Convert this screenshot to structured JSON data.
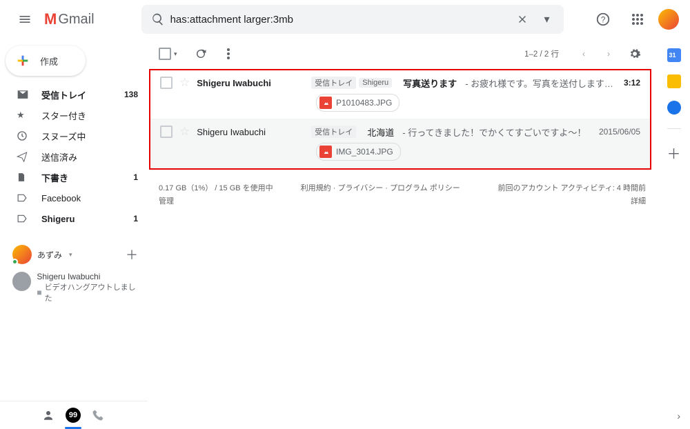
{
  "header": {
    "logo_text": "Gmail",
    "search_value": "has:attachment larger:3mb"
  },
  "compose_label": "作成",
  "nav": [
    {
      "icon": "inbox",
      "label": "受信トレイ",
      "badge": "138",
      "bold": true
    },
    {
      "icon": "star",
      "label": "スター付き",
      "badge": "",
      "bold": false
    },
    {
      "icon": "clock",
      "label": "スヌーズ中",
      "badge": "",
      "bold": false
    },
    {
      "icon": "send",
      "label": "送信済み",
      "badge": "",
      "bold": false
    },
    {
      "icon": "draft",
      "label": "下書き",
      "badge": "1",
      "bold": true
    },
    {
      "icon": "label",
      "label": "Facebook",
      "badge": "",
      "bold": false
    },
    {
      "icon": "label",
      "label": "Shigeru",
      "badge": "1",
      "bold": true
    }
  ],
  "hangouts": {
    "me": "あずみ",
    "contact_name": "Shigeru Iwabuchi",
    "contact_sub": "ビデオハングアウトしました"
  },
  "toolbar": {
    "count": "1–2 / 2 行"
  },
  "messages": [
    {
      "sender": "Shigeru Iwabuchi",
      "bold": true,
      "chips": [
        "受信トレイ",
        "Shigeru"
      ],
      "subject": "写真送ります",
      "snippet": " - お疲れ様です。写真を送付します…",
      "date": "3:12",
      "attachment": "P1010483.JPG"
    },
    {
      "sender": "Shigeru Iwabuchi",
      "bold": false,
      "chips": [
        "受信トレイ"
      ],
      "subject": "北海道",
      "snippet": " - 行ってきました！でかくてすごいですよ〜！",
      "date": "2015/06/05",
      "attachment": "IMG_3014.JPG"
    }
  ],
  "footer": {
    "storage_line1": "0.17 GB（1%） / 15 GB を使用中",
    "storage_line2": "管理",
    "center": "利用規約 · プライバシー · プログラム ポリシー",
    "right_line1": "前回のアカウント アクティビティ: 4 時間前",
    "right_line2": "詳細"
  }
}
